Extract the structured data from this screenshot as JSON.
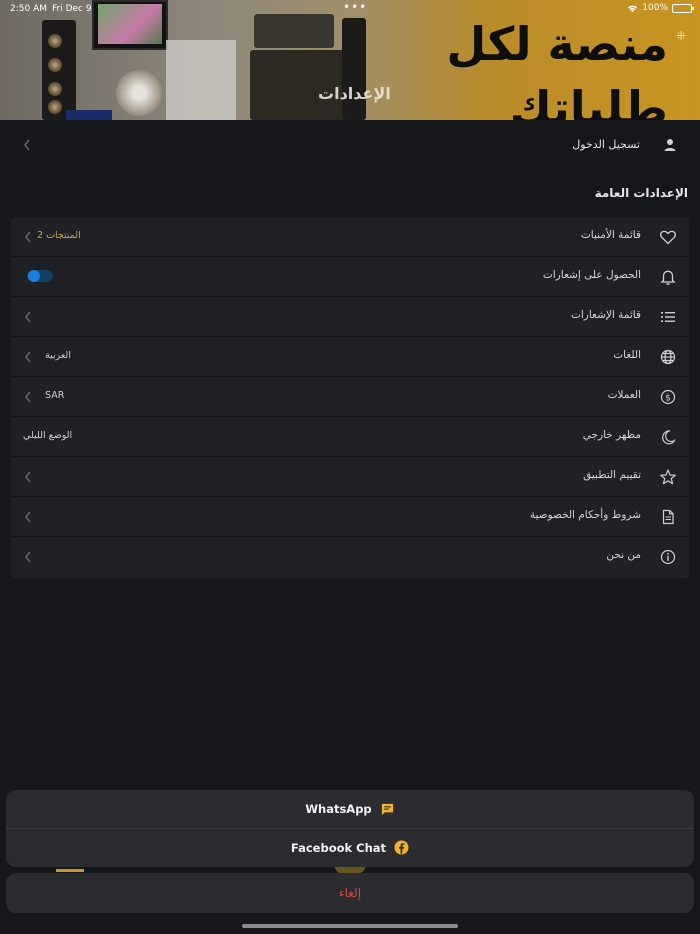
{
  "status_bar": {
    "time": "2:50 AM",
    "date": "Fri Dec 9",
    "battery": "100%"
  },
  "banner": {
    "headline": "منصة لكل طلباتك",
    "page_title": "الإعدادات"
  },
  "login": {
    "label": "تسجيل الدخول",
    "icon": "person-icon"
  },
  "section_title": "الإعدادات العامة",
  "settings": {
    "items": [
      {
        "label": "قائمة الأمنيات",
        "value": "2 المنتجات",
        "icon": "heart-icon"
      },
      {
        "label": "الحصول على إشعارات",
        "value": "",
        "icon": "bell-icon",
        "toggle_on": true
      },
      {
        "label": "قائمة الإشعارات",
        "value": "",
        "icon": "list-icon"
      },
      {
        "label": "اللغات",
        "value": "العربية",
        "icon": "globe-icon"
      },
      {
        "label": "العملات",
        "value": "SAR",
        "icon": "dollar-circle-icon"
      },
      {
        "label": "مظهر خارجي",
        "value": "الوضع الليلي",
        "icon": "moon-icon"
      },
      {
        "label": "تقييم التطبيق",
        "value": "",
        "icon": "star-icon"
      },
      {
        "label": "شروط وأحكام الخصوصية",
        "value": "",
        "icon": "document-icon"
      },
      {
        "label": "من نحن",
        "value": "",
        "icon": "info-icon"
      }
    ]
  },
  "action_sheet": {
    "options": [
      {
        "label": "WhatsApp",
        "icon": "chat-bubble-icon"
      },
      {
        "label": "Facebook Chat",
        "icon": "facebook-icon"
      }
    ],
    "cancel_label": "إلغاء"
  },
  "colors": {
    "accent": "#d9a436",
    "destructive": "#e0433f",
    "toggle": "#1e7de0",
    "background": "#16171b"
  }
}
